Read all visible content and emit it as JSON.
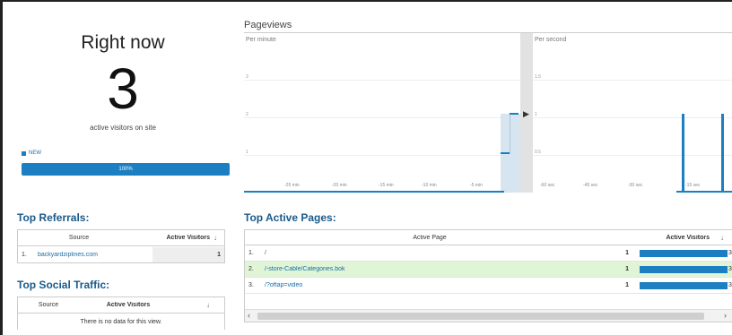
{
  "right_now": {
    "title": "Right now",
    "count": "3",
    "subtitle": "active visitors on site",
    "legend_label": "NEW",
    "bar_label": "100%",
    "new_fraction": 1.0
  },
  "pageviews": {
    "title": "Pageviews",
    "per_minute": {
      "label": "Per minute",
      "y_labels": [
        "3",
        "2",
        "1"
      ],
      "x_ticks": [
        "-25 min",
        "-20 min",
        "-15 min",
        "-10 min",
        "-5 min"
      ]
    },
    "per_second": {
      "label": "Per second",
      "y_labels": [
        "1.5",
        "1",
        "0.5"
      ],
      "x_ticks": [
        "-60 sec",
        "-45 sec",
        "-30 sec",
        "-15 sec"
      ]
    }
  },
  "top_referrals": {
    "title": "Top Referrals:",
    "columns": [
      "Source",
      "Active Visitors"
    ],
    "rows": [
      {
        "num": "1.",
        "source": "backyardziplines.com",
        "visitors": "1"
      }
    ]
  },
  "top_social": {
    "title": "Top Social Traffic:",
    "columns": [
      "Source",
      "Active Visitors"
    ],
    "empty": "There is no data for this view."
  },
  "top_pages": {
    "title": "Top Active Pages:",
    "columns": [
      "Active Page",
      "Active Visitors"
    ],
    "rows": [
      {
        "num": "1.",
        "page": "/",
        "visitors": "1",
        "bar_label": "3"
      },
      {
        "num": "2.",
        "page": "/-store-Cable/Categories.bok",
        "visitors": "1",
        "bar_label": "3"
      },
      {
        "num": "3.",
        "page": "/?oftap=video",
        "visitors": "1",
        "bar_label": "3"
      }
    ]
  },
  "colors": {
    "accent": "#1b7fc1",
    "header": "#1a5a8a",
    "highlight_row": "#dff5d6"
  }
}
